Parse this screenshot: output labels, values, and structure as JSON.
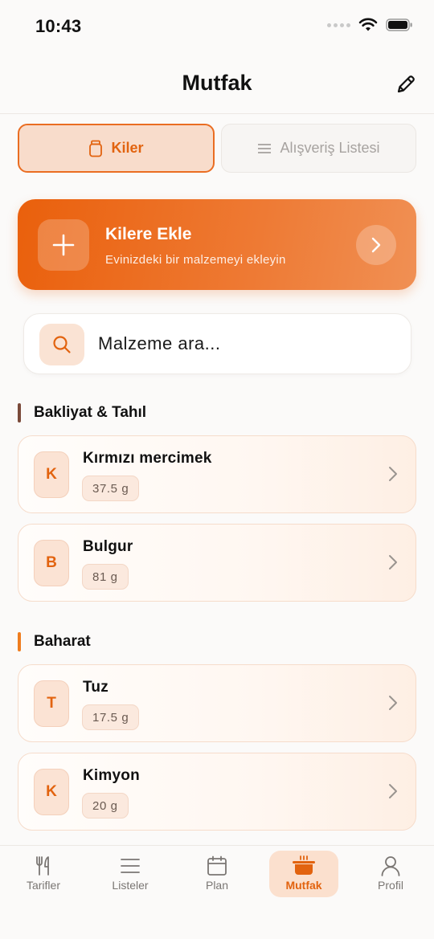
{
  "status": {
    "time": "10:43"
  },
  "header": {
    "title": "Mutfak",
    "edit_icon": "pencil-icon"
  },
  "segments": [
    {
      "label": "Kiler",
      "icon": "jar-icon",
      "active": true
    },
    {
      "label": "Alışveriş Listesi",
      "icon": "list-icon",
      "active": false
    }
  ],
  "add_card": {
    "title": "Kilere Ekle",
    "subtitle": "Evinizdeki bir malzemeyi ekleyin"
  },
  "search": {
    "placeholder": "Malzeme ara..."
  },
  "sections": [
    {
      "title": "Bakliyat & Tahıl",
      "color": "#7a4a3a",
      "items": [
        {
          "initial": "K",
          "name": "Kırmızı mercimek",
          "qty": "37.5 g"
        },
        {
          "initial": "B",
          "name": "Bulgur",
          "qty": "81 g"
        }
      ]
    },
    {
      "title": "Baharat",
      "color": "#ef7d1f",
      "items": [
        {
          "initial": "T",
          "name": "Tuz",
          "qty": "17.5 g"
        },
        {
          "initial": "K",
          "name": "Kimyon",
          "qty": "20 g"
        }
      ]
    }
  ],
  "tabs": [
    {
      "label": "Tarifler",
      "icon": "fork-knife-icon"
    },
    {
      "label": "Listeler",
      "icon": "list-icon"
    },
    {
      "label": "Plan",
      "icon": "calendar-icon"
    },
    {
      "label": "Mutfak",
      "icon": "pot-icon",
      "active": true
    },
    {
      "label": "Profil",
      "icon": "person-icon"
    }
  ],
  "colors": {
    "accent": "#ea6d22",
    "accent_light": "#fbe0ce"
  }
}
